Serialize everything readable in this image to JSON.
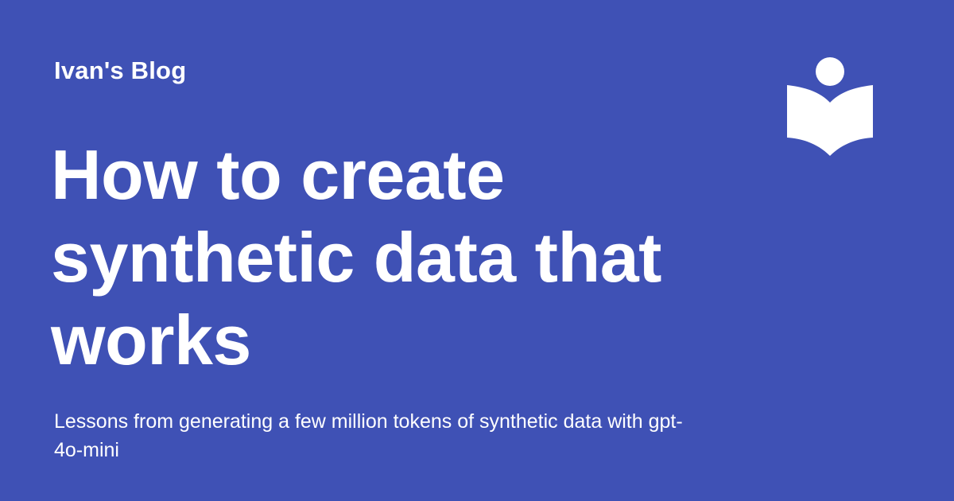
{
  "header": {
    "site_name": "Ivan's Blog",
    "logo_icon": "reader-book-icon"
  },
  "post": {
    "title": "How to create synthetic data that works",
    "subtitle": "Lessons from generating a few million tokens of synthetic data with gpt-4o-mini"
  },
  "colors": {
    "background": "#3f51b5",
    "foreground": "#ffffff"
  }
}
